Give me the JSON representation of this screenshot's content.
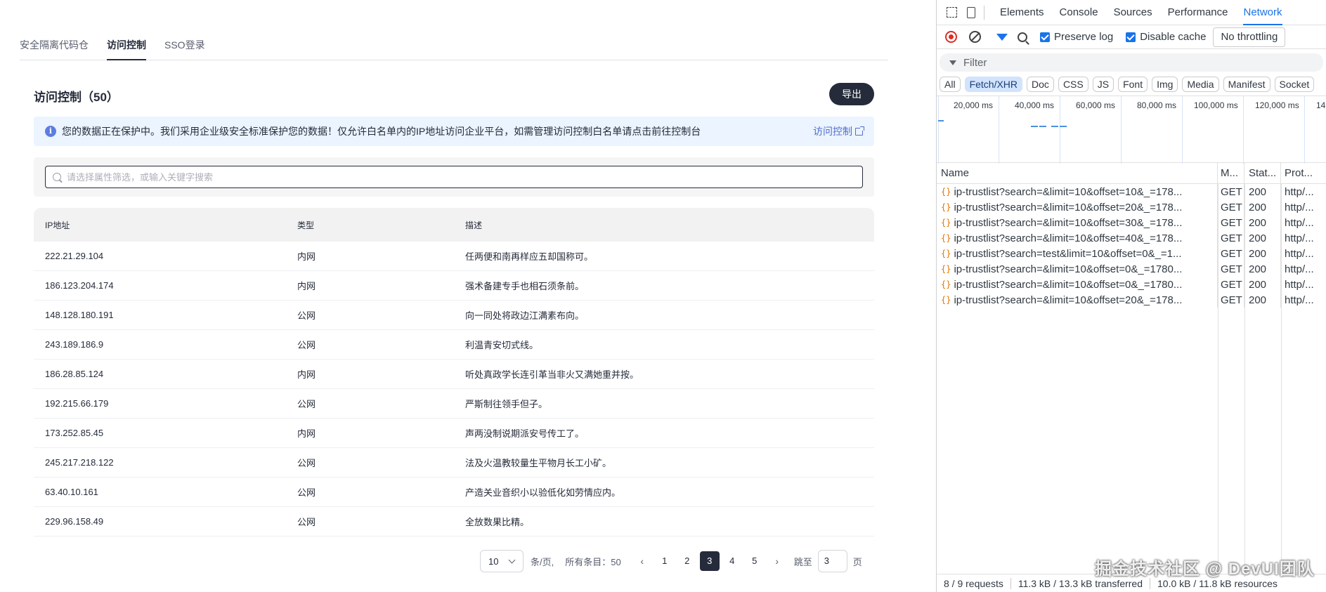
{
  "tabs": [
    "安全隔离代码仓",
    "访问控制",
    "SSO登录"
  ],
  "active_tab": 1,
  "page_title": "访问控制（50）",
  "export_label": "导出",
  "notice": {
    "text": "您的数据正在保护中。我们采用企业级安全标准保护您的数据！仅允许白名单内的IP地址访问企业平台，如需管理访问控制白名单请点击前往控制台",
    "link": "访问控制"
  },
  "search": {
    "placeholder": "请选择属性筛选，或输入关键字搜索",
    "value": ""
  },
  "table": {
    "headers": [
      "IP地址",
      "类型",
      "描述"
    ],
    "rows": [
      [
        "222.21.29.104",
        "内网",
        "任两便和南再样应五却国称可。"
      ],
      [
        "186.123.204.174",
        "内网",
        "强术备建专手也相石须条前。"
      ],
      [
        "148.128.180.191",
        "公网",
        "向一同处将政边江满素布向。"
      ],
      [
        "243.189.186.9",
        "公网",
        "利温青安切式线。"
      ],
      [
        "186.28.85.124",
        "内网",
        "听处真政学长连引革当非火又满她重并按。"
      ],
      [
        "192.215.66.179",
        "公网",
        "严斯制往领手但子。"
      ],
      [
        "173.252.85.45",
        "内网",
        "声两没制说期派安号传工了。"
      ],
      [
        "245.217.218.122",
        "公网",
        "法及火温教较量生平物月长工小矿。"
      ],
      [
        "63.40.10.161",
        "公网",
        "产造关业音织小以验低化如劳情应内。"
      ],
      [
        "229.96.158.49",
        "公网",
        "全放数果比精。"
      ]
    ]
  },
  "pagination": {
    "page_size": "10",
    "per_page_label": "条/页,",
    "total_label": "所有条目：50",
    "pages": [
      "1",
      "2",
      "3",
      "4",
      "5"
    ],
    "current": 3,
    "prev": "‹",
    "next": "›",
    "jump_label": "跳至",
    "jump_value": "3",
    "page_unit": "页"
  },
  "devtools": {
    "tabs": [
      "Elements",
      "Console",
      "Sources",
      "Performance",
      "Network"
    ],
    "active_tab": "Network",
    "preserve_log": "Preserve log",
    "disable_cache": "Disable cache",
    "throttling": "No throttling",
    "filter_placeholder": "Filter",
    "types": [
      "All",
      "Fetch/XHR",
      "Doc",
      "CSS",
      "JS",
      "Font",
      "Img",
      "Media",
      "Manifest",
      "Socket"
    ],
    "active_type": "Fetch/XHR",
    "timeline_labels": [
      "20,000 ms",
      "40,000 ms",
      "60,000 ms",
      "80,000 ms",
      "100,000 ms",
      "120,000 ms",
      "14"
    ],
    "columns": [
      "Name",
      "M...",
      "Stat...",
      "Prot..."
    ],
    "requests": [
      {
        "name": "ip-trustlist?search=&limit=10&offset=10&_=178...",
        "method": "GET",
        "status": "200",
        "protocol": "http/..."
      },
      {
        "name": "ip-trustlist?search=&limit=10&offset=20&_=178...",
        "method": "GET",
        "status": "200",
        "protocol": "http/..."
      },
      {
        "name": "ip-trustlist?search=&limit=10&offset=30&_=178...",
        "method": "GET",
        "status": "200",
        "protocol": "http/..."
      },
      {
        "name": "ip-trustlist?search=&limit=10&offset=40&_=178...",
        "method": "GET",
        "status": "200",
        "protocol": "http/..."
      },
      {
        "name": "ip-trustlist?search=test&limit=10&offset=0&_=1...",
        "method": "GET",
        "status": "200",
        "protocol": "http/..."
      },
      {
        "name": "ip-trustlist?search=&limit=10&offset=0&_=1780...",
        "method": "GET",
        "status": "200",
        "protocol": "http/..."
      },
      {
        "name": "ip-trustlist?search=&limit=10&offset=0&_=1780...",
        "method": "GET",
        "status": "200",
        "protocol": "http/..."
      },
      {
        "name": "ip-trustlist?search=&limit=10&offset=20&_=178...",
        "method": "GET",
        "status": "200",
        "protocol": "http/..."
      }
    ],
    "status_bar": [
      "8 / 9 requests",
      "11.3 kB / 13.3 kB transferred",
      "10.0 kB / 11.8 kB resources"
    ]
  },
  "watermark": "掘金技术社区 @ DevUI团队"
}
